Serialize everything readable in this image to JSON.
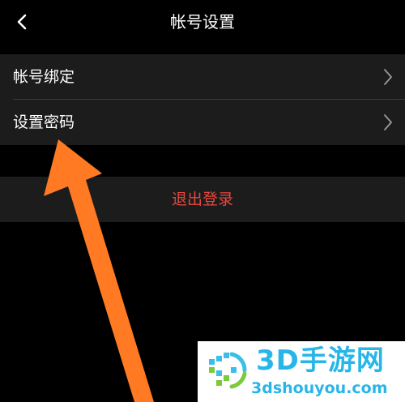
{
  "header": {
    "title": "帐号设置",
    "back_icon": "chevron-left-icon"
  },
  "settings": {
    "items": [
      {
        "label": "帐号绑定",
        "icon": "chevron-right-icon"
      },
      {
        "label": "设置密码",
        "icon": "chevron-right-icon"
      }
    ]
  },
  "logout": {
    "label": "退出登录",
    "color": "#e8473c"
  },
  "annotation": {
    "icon": "orange-arrow-icon",
    "color": "#ff7a22"
  },
  "watermark": {
    "title": "3D手游网",
    "domain": "3dshouyou.com",
    "color": "#28b6e8"
  }
}
